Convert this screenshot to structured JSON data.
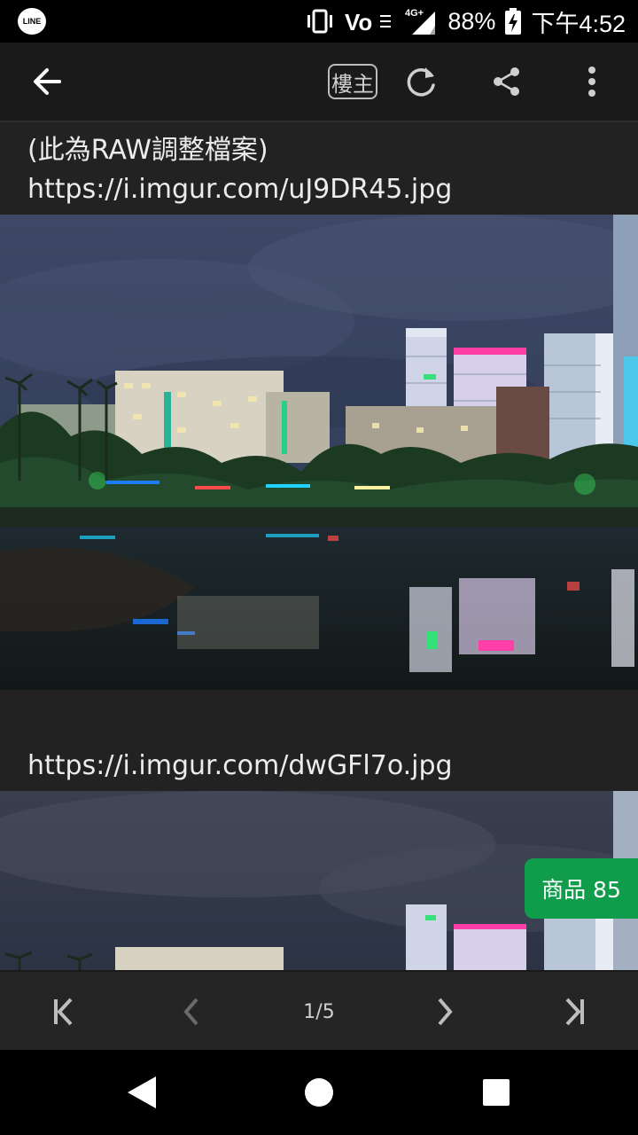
{
  "status_bar": {
    "line_label": "LINE",
    "network": "4G+",
    "battery": "88%",
    "time": "下午4:52"
  },
  "app_bar": {
    "back_icon": "arrow-left-icon",
    "op_label": "樓主",
    "refresh_icon": "refresh-icon",
    "share_icon": "share-icon",
    "more_icon": "more-vert-icon"
  },
  "post": {
    "caption": "(此為RAW調整檔案)",
    "link_1": "https://i.imgur.com/uJ9DR45.jpg",
    "link_2": "https://i.imgur.com/dwGFl7o.jpg"
  },
  "goods_button": {
    "label": "商品 85"
  },
  "pager": {
    "page_indicator": "1/5",
    "first_icon": "first-page-icon",
    "prev_icon": "chevron-left-icon",
    "next_icon": "chevron-right-icon",
    "last_icon": "last-page-icon"
  },
  "colors": {
    "accent_green": "#0f9d4b",
    "background": "#222222",
    "app_bar": "#1a1a1a"
  }
}
